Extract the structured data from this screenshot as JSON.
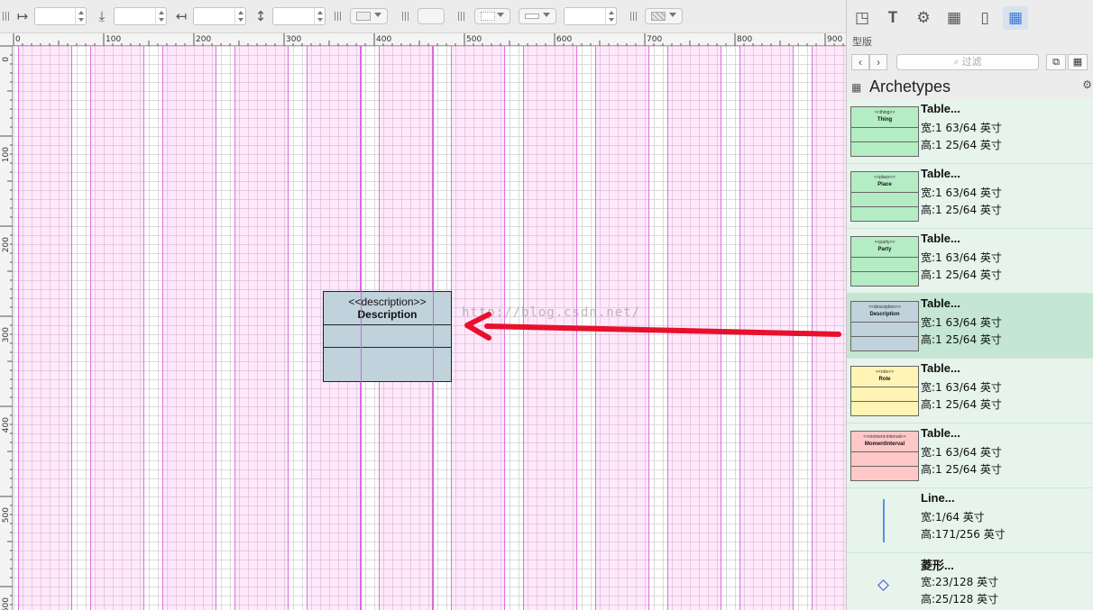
{
  "ruler": {
    "top_labels": [
      "0",
      "100",
      "200",
      "300",
      "400",
      "500",
      "600",
      "700",
      "800",
      "900"
    ],
    "left_labels": [
      "0",
      "100",
      "200",
      "300",
      "400",
      "500",
      "600"
    ]
  },
  "canvas": {
    "watermark": "http://blog.csdn.net/",
    "table": {
      "stereotype": "<<description>>",
      "name": "Description",
      "color": "#c0d2dc"
    }
  },
  "panel": {
    "title": "型版",
    "filter_placeholder": "过滤",
    "stencil_title": "Archetypes",
    "items": [
      {
        "name": "Table...",
        "width": "宽:1 63/64 英寸",
        "height": "高:1 25/64 英寸",
        "kind": "table",
        "stereotype": "<<thing>>",
        "label": "Thing",
        "color": "#b4ecc4"
      },
      {
        "name": "Table...",
        "width": "宽:1 63/64 英寸",
        "height": "高:1 25/64 英寸",
        "kind": "table",
        "stereotype": "<<place>>",
        "label": "Place",
        "color": "#b4ecc4"
      },
      {
        "name": "Table...",
        "width": "宽:1 63/64 英寸",
        "height": "高:1 25/64 英寸",
        "kind": "table",
        "stereotype": "<<party>>",
        "label": "Party",
        "color": "#b4ecc4"
      },
      {
        "name": "Table...",
        "width": "宽:1 63/64 英寸",
        "height": "高:1 25/64 英寸",
        "kind": "table",
        "stereotype": "<<description>>",
        "label": "Description",
        "color": "#c0d2dc",
        "selected": true
      },
      {
        "name": "Table...",
        "width": "宽:1 63/64 英寸",
        "height": "高:1 25/64 英寸",
        "kind": "table",
        "stereotype": "<<role>>",
        "label": "Role",
        "color": "#fff4b4"
      },
      {
        "name": "Table...",
        "width": "宽:1 63/64 英寸",
        "height": "高:1 25/64 英寸",
        "kind": "table",
        "stereotype": "<<moment-interval>>",
        "label": "MomentInterval",
        "color": "#ffc8c8"
      },
      {
        "name": "Line...",
        "width": "宽:1/64 英寸",
        "height": "高:171/256 英寸",
        "kind": "line"
      },
      {
        "name": "菱形...",
        "width": "宽:23/128 英寸",
        "height": "高:25/128 英寸",
        "kind": "diamond"
      }
    ]
  },
  "icons": {
    "inspector_tabs": [
      "resize-icon",
      "text-icon",
      "gear-icon",
      "layout-icon",
      "document-icon",
      "stencils-icon"
    ]
  },
  "colors": {
    "arrow": "#e8102c",
    "guide": "#d860d8",
    "selection": "#c4e6d2"
  }
}
